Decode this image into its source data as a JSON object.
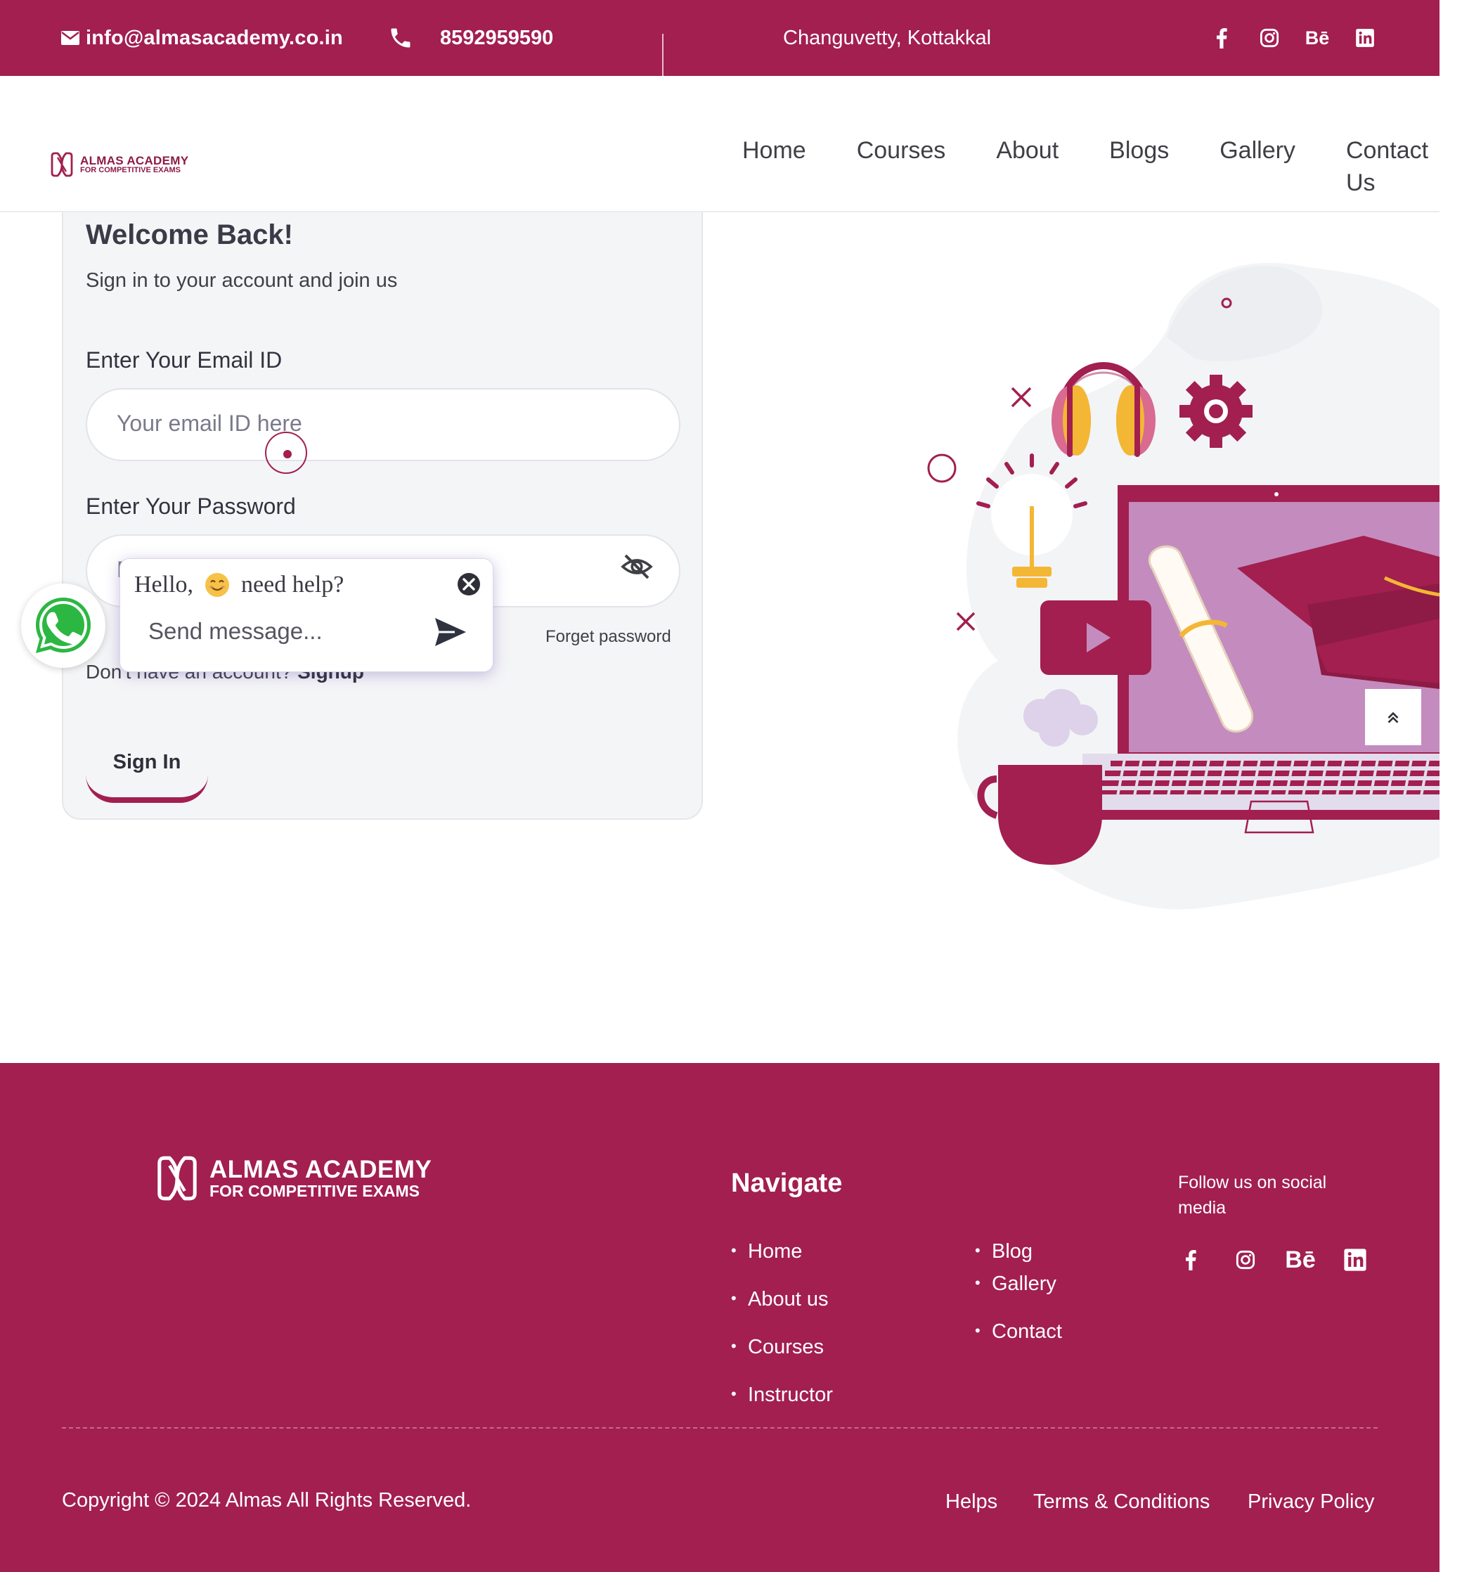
{
  "topbar": {
    "email": "info@almasacademy.co.in",
    "phone": "8592959590",
    "location": "Changuvetty, Kottakkal",
    "social_icons": [
      "facebook-icon",
      "instagram-icon",
      "behance-icon",
      "linkedin-icon"
    ],
    "behance_text": "Bē"
  },
  "brand": {
    "name": "ALMAS ACADEMY",
    "tagline": "FOR COMPETITIVE EXAMS",
    "primary_color": "#a21f4f"
  },
  "nav": {
    "items": [
      "Home",
      "Courses",
      "About",
      "Blogs",
      "Gallery",
      "Contact Us"
    ]
  },
  "login": {
    "title": "Welcome Back!",
    "subtitle": "Sign in to your account and join us",
    "email_label": "Enter Your Email ID",
    "email_placeholder": "Your email ID here",
    "password_label": "Enter Your Password",
    "password_placeholder": "P",
    "forget_password": "Forget password",
    "no_account_text": "Don't have an account?",
    "signup_label": "Signup",
    "signin_label": "Sign In"
  },
  "chat": {
    "greeting_before": "Hello,",
    "greeting_after": "need help?",
    "message_placeholder": "Send message..."
  },
  "footer": {
    "navigate_title": "Navigate",
    "nav_col1": [
      "Home",
      "About us",
      "Courses",
      "Instructor"
    ],
    "nav_col2": [
      "Blog",
      "Gallery",
      "Contact"
    ],
    "follow_text": "Follow us on social media",
    "copyright": "Copyright © 2024 Almas All Rights Reserved.",
    "links": [
      "Helps",
      "Terms & Conditions",
      "Privacy Policy"
    ]
  }
}
